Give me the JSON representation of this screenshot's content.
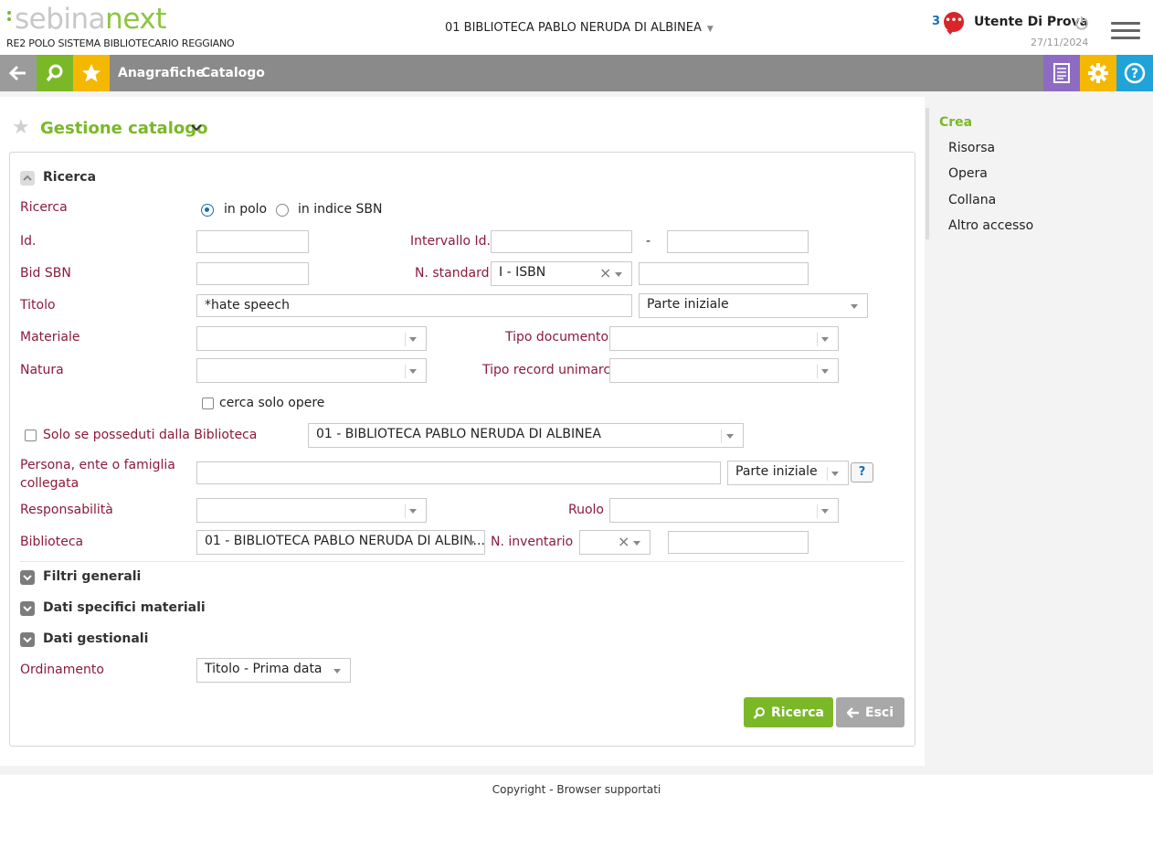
{
  "header": {
    "logo_part1": "sebina",
    "logo_part2": "next",
    "subtitle": "RE2 POLO SISTEMA BIBLIOTECARIO REGGIANO",
    "library": "01 BIBLIOTECA PABLO NERUDA DI ALBINEA",
    "message_count": "3",
    "username": "Utente Di Prova",
    "date": "27/11/2024"
  },
  "toolbar": {
    "links": [
      "Anagrafiche",
      "Catalogo"
    ],
    "colors": {
      "back": "#9b9b9b",
      "search": "#7ab828",
      "favorites": "#f5b800",
      "docs": "#8e6bc3",
      "settings": "#f5b800",
      "help": "#1fa3d9"
    }
  },
  "page": {
    "title": "Gestione catalogo"
  },
  "sidebar": {
    "title": "Crea",
    "items": [
      "Risorsa",
      "Opera",
      "Collana",
      "Altro accesso"
    ]
  },
  "form": {
    "section_title": "Ricerca",
    "search_label": "Ricerca",
    "radio_polo": "in polo",
    "radio_sbn": "in indice SBN",
    "radio_selected": "in polo",
    "id_label": "Id.",
    "id_value": "",
    "interval_label": "Intervallo Id.",
    "interval_from": "",
    "interval_sep": "-",
    "interval_to": "",
    "bid_label": "Bid SBN",
    "bid_value": "",
    "standard_label": "N. standard",
    "standard_type": "I - ISBN",
    "standard_value": "",
    "title_label": "Titolo",
    "title_value": "*hate speech",
    "title_mode": "Parte iniziale",
    "material_label": "Materiale",
    "material_value": "",
    "doc_type_label": "Tipo documento",
    "doc_type_value": "",
    "nature_label": "Natura",
    "nature_value": "",
    "unimarc_label": "Tipo record unimarc",
    "unimarc_value": "",
    "only_works_label": "cerca solo opere",
    "owned_label": "Solo se posseduti dalla Biblioteca",
    "owned_library": "01 - BIBLIOTECA PABLO NERUDA DI ALBINEA",
    "person_label": "Persona, ente o famiglia collegata",
    "person_value": "",
    "person_mode": "Parte iniziale",
    "help_label": "?",
    "responsibility_label": "Responsabilità",
    "responsibility_value": "",
    "role_label": "Ruolo",
    "role_value": "",
    "library_label": "Biblioteca",
    "library_value": "01 - BIBLIOTECA PABLO NERUDA DI ALBIN...",
    "inventory_label": "N. inventario",
    "inventory_series": "",
    "inventory_value": "",
    "filters_title": "Filtri generali",
    "material_data_title": "Dati specifici materiali",
    "management_title": "Dati gestionali",
    "order_label": "Ordinamento",
    "order_value": "Titolo - Prima data",
    "search_button": "Ricerca",
    "exit_button": "Esci"
  },
  "footer": {
    "copyright": "Copyright",
    "separator": "-",
    "browsers": "Browser supportati"
  }
}
